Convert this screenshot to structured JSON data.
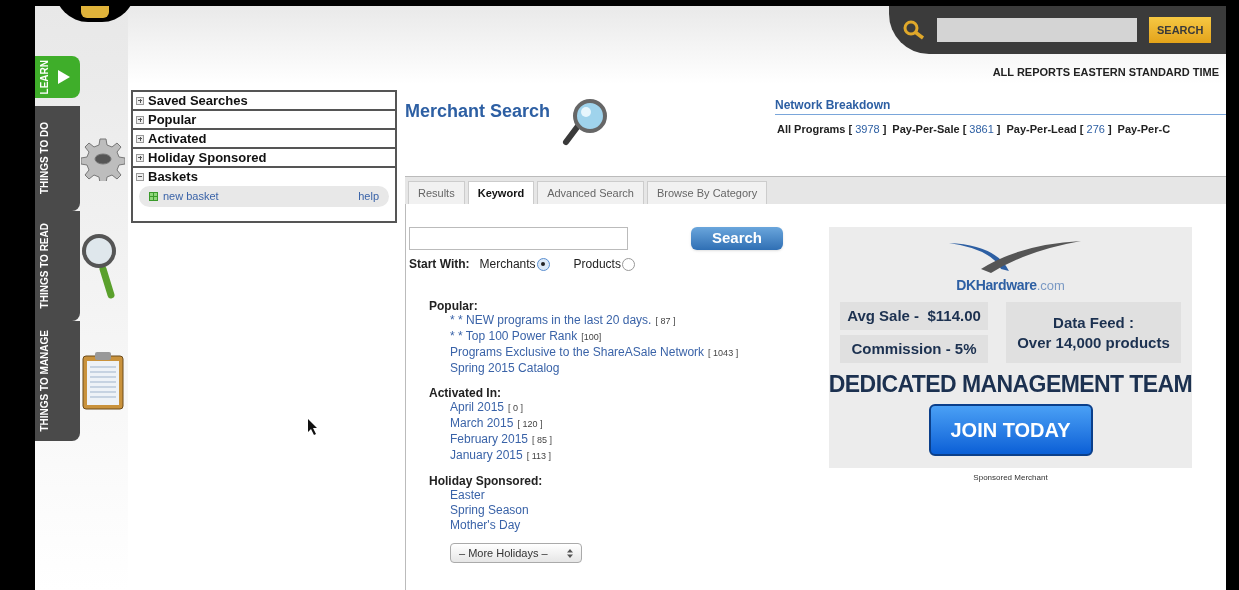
{
  "nav_tabs": [
    {
      "label": "LEARN",
      "selected": true
    },
    {
      "label": "THINGS TO DO",
      "selected": false
    },
    {
      "label": "THINGS TO READ",
      "selected": false
    },
    {
      "label": "THINGS TO MANAGE",
      "selected": false
    }
  ],
  "top_search": {
    "button": "SEARCH"
  },
  "timezone_note": "ALL REPORTS EASTERN STANDARD TIME",
  "side_panel": {
    "sections": [
      {
        "label": "Saved Searches",
        "expanded": false
      },
      {
        "label": "Popular",
        "expanded": false
      },
      {
        "label": "Activated",
        "expanded": false
      },
      {
        "label": "Holiday Sponsored",
        "expanded": false
      },
      {
        "label": "Baskets",
        "expanded": true,
        "items": [
          {
            "label": "new basket",
            "help": "help"
          }
        ]
      }
    ]
  },
  "page_title": "Merchant Search",
  "network_breakdown": {
    "title": "Network Breakdown",
    "stats": [
      {
        "label": "All Programs [",
        "count": "3978",
        "close": "]"
      },
      {
        "label": "Pay-Per-Sale [",
        "count": "3861",
        "close": "]"
      },
      {
        "label": "Pay-Per-Lead [",
        "count": "276",
        "close": "]"
      },
      {
        "label": "Pay-Per-C"
      }
    ]
  },
  "tabs": [
    {
      "label": "Results",
      "selected": false
    },
    {
      "label": "Keyword",
      "selected": true
    },
    {
      "label": "Advanced Search",
      "selected": false
    },
    {
      "label": "Browse By Category",
      "selected": false
    }
  ],
  "search": {
    "button": "Search",
    "start_with": "Start With:",
    "options": [
      {
        "label": "Merchants",
        "selected": true
      },
      {
        "label": "Products",
        "selected": false
      }
    ]
  },
  "groups": [
    {
      "title": "Popular:",
      "links": [
        {
          "text": "* * NEW programs in the last 20 days.",
          "count": "[ 87 ]"
        },
        {
          "text": "* * Top 100 Power Rank",
          "count": "[100]"
        },
        {
          "text": "Programs Exclusive to the ShareASale Network",
          "count": "[ 1043 ]"
        },
        {
          "text": "Spring 2015 Catalog"
        }
      ]
    },
    {
      "title": "Activated In:",
      "links": [
        {
          "text": "April 2015",
          "count": "[ 0 ]"
        },
        {
          "text": "March 2015",
          "count": "[ 120 ]"
        },
        {
          "text": "February 2015",
          "count": "[ 85 ]"
        },
        {
          "text": "January 2015",
          "count": "[ 113 ]"
        }
      ]
    },
    {
      "title": "Holiday Sponsored:",
      "links": [
        {
          "text": "Easter"
        },
        {
          "text": "Spring Season"
        },
        {
          "text": "Mother's Day"
        }
      ]
    }
  ],
  "more_holidays": "– More Holidays –",
  "ad": {
    "brand": "DKHardware",
    "brand_suffix": ".com",
    "avg_sale": "Avg Sale -  $114.00",
    "commission": "Commission - 5%",
    "data_feed": "Data Feed :",
    "data_feed_detail": "Over 14,000 products",
    "headline": "DEDICATED MANAGEMENT TEAM",
    "button": "JOIN TODAY"
  },
  "ad_caption": "Sponsored Merchant"
}
